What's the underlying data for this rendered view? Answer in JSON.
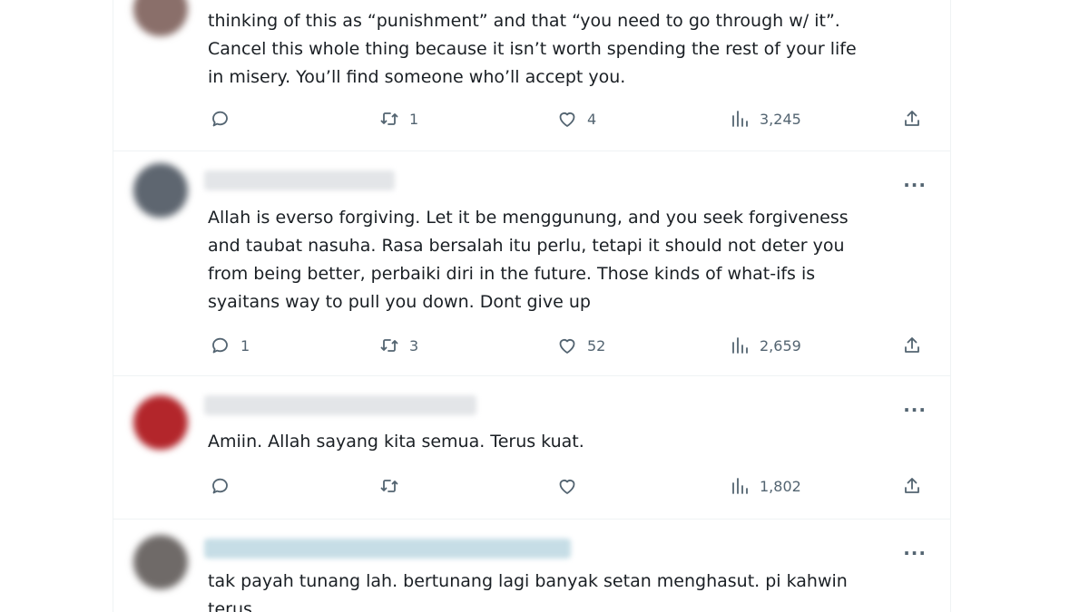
{
  "tweets": [
    {
      "text": "thinking of this as “punishment” and that “you need to go through w/ it”.\nCancel this whole thing because it isn’t worth spending the rest of your life\nin misery. You’ll find someone who’ll accept you.",
      "replies": "",
      "retweets": "1",
      "likes": "4",
      "views": "3,245"
    },
    {
      "text": "Allah is everso forgiving. Let it be menggunung, and you seek forgiveness\nand taubat nasuha. Rasa bersalah itu perlu, tetapi it should not deter you\nfrom being better, perbaiki diri in the future. Those kinds of what-ifs is\nsyaitans way to pull you down. Dont give up",
      "replies": "1",
      "retweets": "3",
      "likes": "52",
      "views": "2,659"
    },
    {
      "text": "Amiin. Allah sayang kita semua. Terus kuat.",
      "replies": "",
      "retweets": "",
      "likes": "",
      "views": "1,802"
    },
    {
      "text": "tak payah tunang lah. bertunang lagi banyak setan menghasut. pi kahwin\nterus",
      "replies": "",
      "retweets": "",
      "likes": "",
      "views": ""
    }
  ],
  "more_label": "···",
  "icons": {
    "reply": "reply-icon",
    "retweet": "retweet-icon",
    "like": "heart-icon",
    "views": "views-chart-icon",
    "share": "share-icon",
    "more": "more-options-icon"
  },
  "colors": {
    "icon_gray": "#536471",
    "text": "#1a1f24",
    "divider": "#eff3f4"
  }
}
